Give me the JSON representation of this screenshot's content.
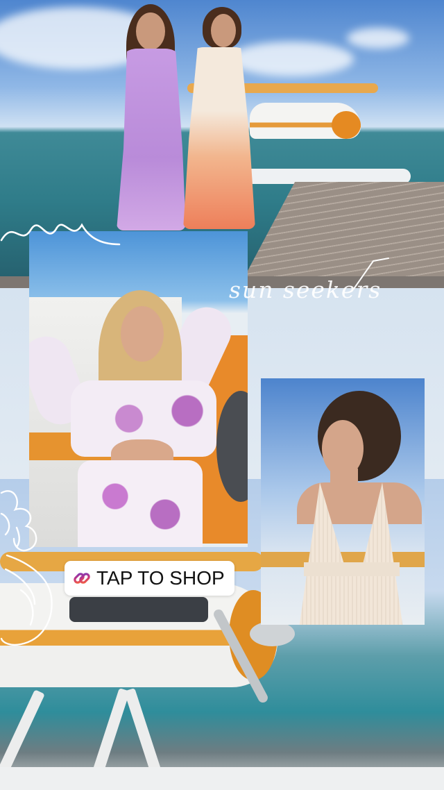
{
  "story": {
    "caption": "sun seekers",
    "shop_sticker": {
      "label": "TAP TO SHOP",
      "icon": "link-icon",
      "icon_gradient": [
        "#f56040",
        "#c13584",
        "#833ab4"
      ]
    }
  },
  "colors": {
    "sea": "#2f7c89",
    "sky": "#6ea0df",
    "plane_orange": "#e8a23a",
    "band": "#dbe7f3"
  }
}
